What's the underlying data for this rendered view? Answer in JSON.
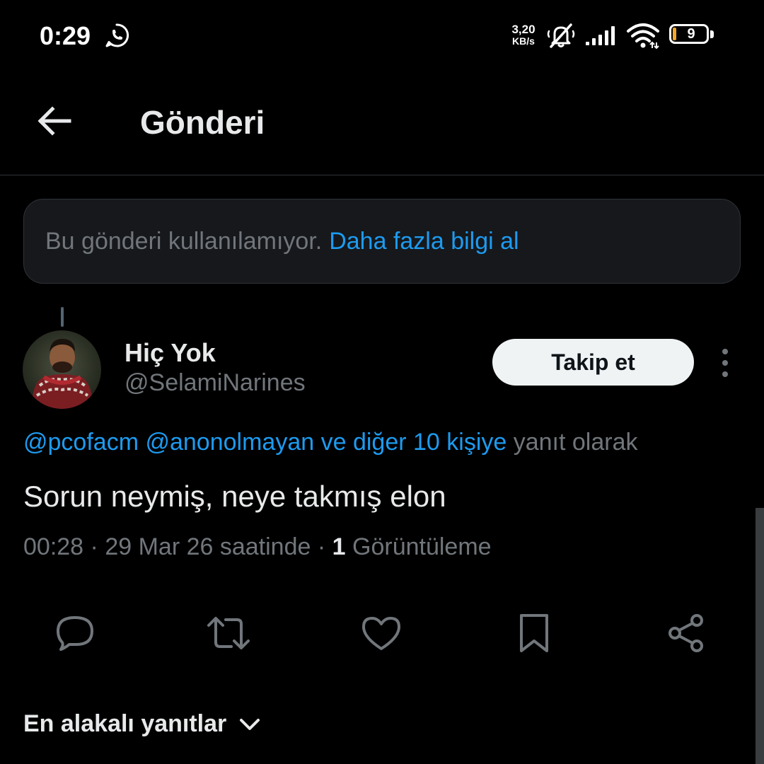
{
  "status_bar": {
    "time": "0:29",
    "net_speed_value": "3,20",
    "net_speed_unit": "KB/s",
    "battery_level": "9",
    "battery_color": "#f5a623"
  },
  "header": {
    "title": "Gönderi",
    "back_icon": "arrow-left-icon"
  },
  "notice": {
    "text": "Bu gönderi kullanılamıyor.",
    "link": "Daha fazla bilgi al"
  },
  "tweet": {
    "display_name": "Hiç Yok",
    "handle": "@SelamiNarines",
    "follow_label": "Takip et",
    "reply_context": {
      "mention_1": "@pcofacm",
      "mention_2": "@anonolmayan",
      "others": "ve diğer 10 kişiye",
      "suffix": "yanıt olarak"
    },
    "text": "Sorun neymiş, neye takmış elon",
    "meta": {
      "time": "00:28",
      "date": "29 Mar 26 saatinde",
      "views_count": "1",
      "views_label": "Görüntüleme"
    },
    "actions": [
      "reply-icon",
      "retweet-icon",
      "like-icon",
      "bookmark-icon",
      "share-icon"
    ]
  },
  "replies": {
    "sort_label": "En alakalı yanıtlar"
  },
  "colors": {
    "background": "#000000",
    "accent": "#1d9bf0",
    "text_primary": "#e7e9ea",
    "text_secondary": "#71767b",
    "border": "#2f3336"
  }
}
